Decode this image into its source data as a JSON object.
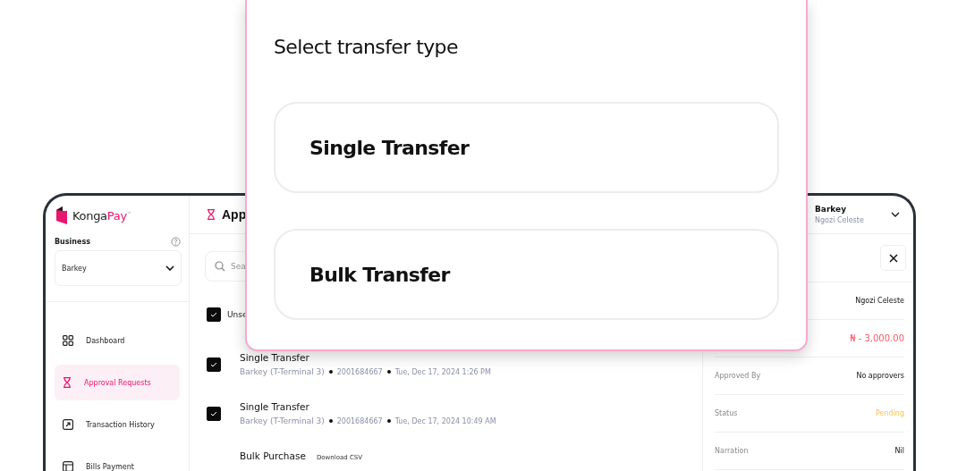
{
  "modal": {
    "title": "Select transfer type",
    "options": [
      {
        "label": "Single Transfer"
      },
      {
        "label": "Bulk Transfer"
      }
    ]
  },
  "sidebar": {
    "logo": {
      "part_1": "Konga",
      "part_2": "Pay",
      "mark": "™"
    },
    "business_label": "Business",
    "business_select": "Barkey",
    "items": [
      {
        "label": "Dashboard",
        "selected": false
      },
      {
        "label": "Approval Requests",
        "selected": true
      },
      {
        "label": "Transaction History",
        "selected": false
      },
      {
        "label": "Bills Payment",
        "selected": false
      }
    ]
  },
  "main": {
    "title": "App",
    "search": {
      "placeholder": "Sea"
    },
    "select_all": {
      "label": "Unse",
      "checked": true
    },
    "requests": [
      {
        "title": "Single Transfer",
        "checked": true,
        "account": "Barkey (T-Terminal 3)",
        "number": "2001684667",
        "time": "Tue, Dec 17, 2024 1:26 PM"
      },
      {
        "title": "Single Transfer",
        "checked": true,
        "account": "Barkey (T-Terminal 3)",
        "number": "2001684667",
        "time": "Tue, Dec 17, 2024 10:49 AM"
      },
      {
        "title": "Bulk Purchase",
        "link": "Download CSV"
      }
    ]
  },
  "detail": {
    "user": {
      "business": "Barkey",
      "name": "Ngozi Celeste"
    },
    "rows": [
      {
        "value": "Ngozi Celeste",
        "kind": "plain"
      },
      {
        "value": "₦ - 3,000.00",
        "kind": "amount"
      },
      {
        "label": "Approved By",
        "value": "No approvers",
        "kind": "plain"
      },
      {
        "label": "Status",
        "value": "Pending",
        "kind": "status"
      },
      {
        "label": "Narration",
        "value": "Nil",
        "kind": "plain"
      }
    ]
  }
}
